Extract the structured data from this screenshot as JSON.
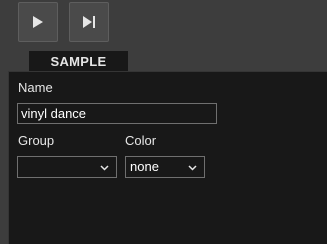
{
  "toolbar": {
    "play_icon": "play-icon",
    "next_icon": "skip-next-icon"
  },
  "tabs": [
    {
      "label": "SAMPLE",
      "active": true
    }
  ],
  "form": {
    "name_label": "Name",
    "name_value": "vinyl dance",
    "group_label": "Group",
    "group_value": "",
    "color_label": "Color",
    "color_value": "none"
  },
  "colors": {
    "background": "#3d3d3d",
    "panel": "#181818",
    "text": "#e6e6e6",
    "border": "#6f6f6f"
  }
}
